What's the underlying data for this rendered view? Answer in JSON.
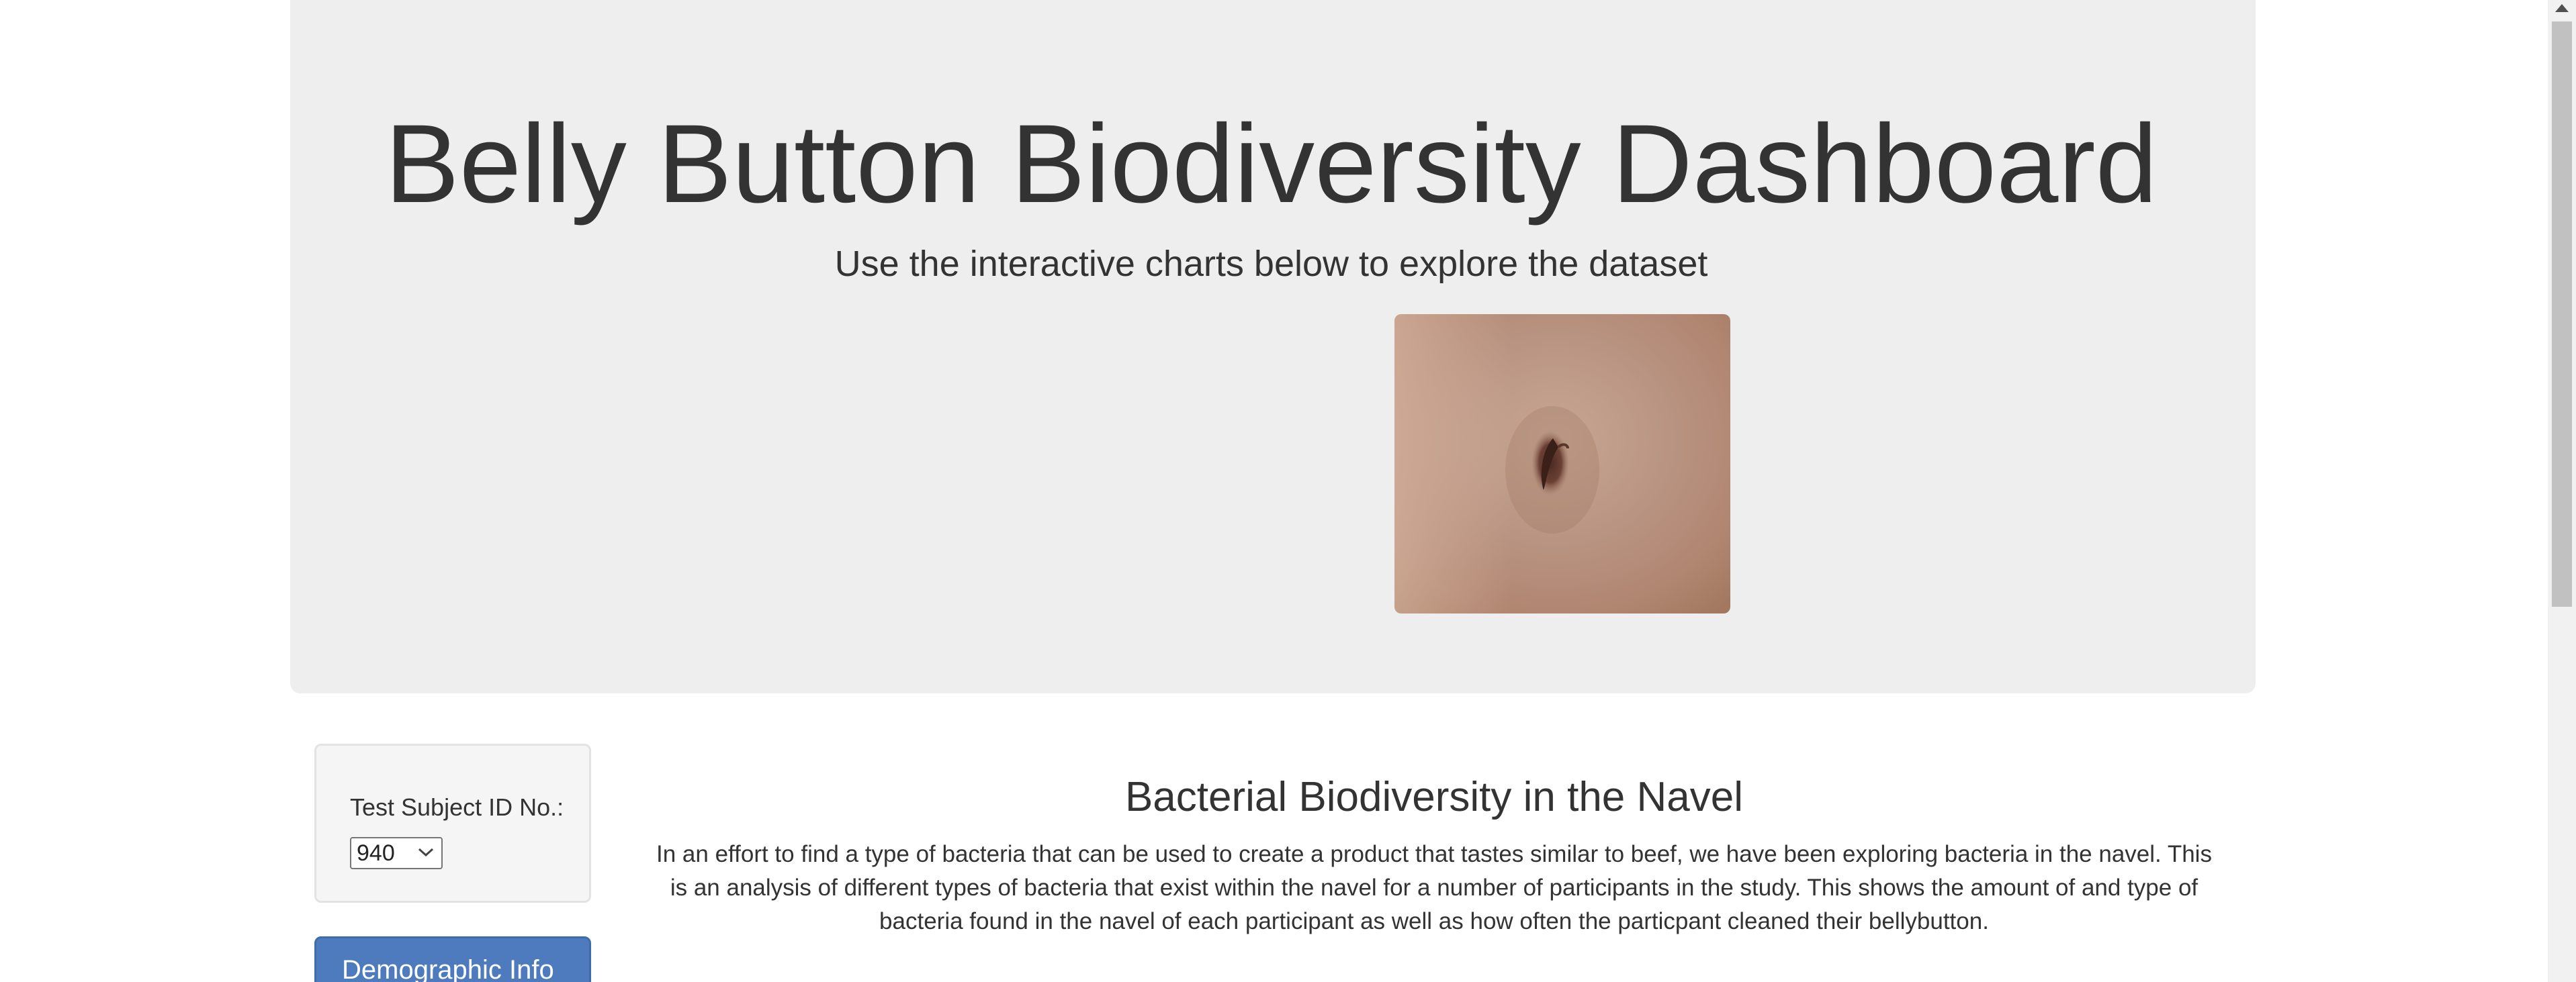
{
  "header": {
    "title": "Belly Button Biodiversity Dashboard",
    "subtitle": "Use the interactive charts below to explore the dataset",
    "image_icon": "navel-photo"
  },
  "sidebar": {
    "selector_label": "Test Subject ID No.:",
    "selected_id": "940",
    "panel_title": "Demographic Info"
  },
  "article": {
    "title": "Bacterial Biodiversity in the Navel",
    "body": "In an effort to find a type of bacteria that can be used to create a product that tastes similar to beef, we have been exploring bacteria in the navel. This is an analysis of different types of bacteria that exist within the navel for a number of participants in the study. This shows the amount of and type of bacteria found in the navel of each participant as well as how often the particpant cleaned their bellybutton."
  },
  "colors": {
    "jumbotron_bg": "#eeeeee",
    "panel_primary": "#4d7bbd",
    "text": "#333333"
  }
}
